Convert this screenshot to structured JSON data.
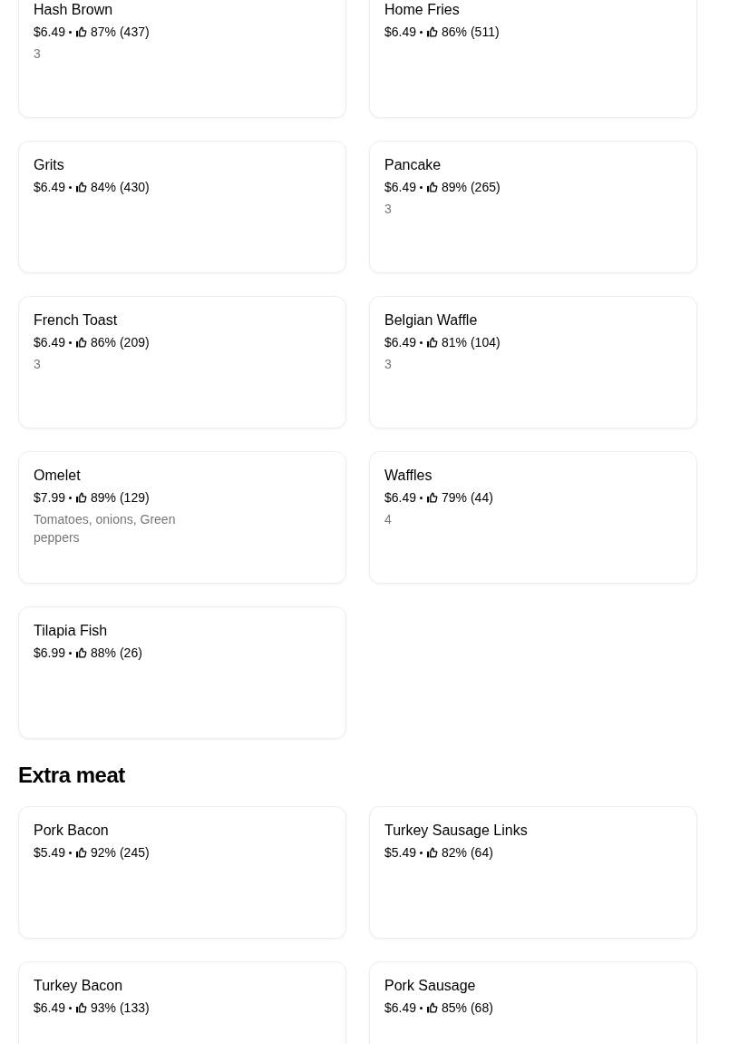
{
  "sections": [
    {
      "items": [
        {
          "name": "Hash Brown",
          "price": "$6.49",
          "rating": "87% (437)",
          "description": "3"
        },
        {
          "name": "Home Fries",
          "price": "$6.49",
          "rating": "86% (511)"
        },
        {
          "name": "Grits",
          "price": "$6.49",
          "rating": "84% (430)"
        },
        {
          "name": "Pancake",
          "price": "$6.49",
          "rating": "89% (265)",
          "description": "3"
        },
        {
          "name": "French Toast",
          "price": "$6.49",
          "rating": "86% (209)",
          "description": "3"
        },
        {
          "name": "Belgian Waffle",
          "price": "$6.49",
          "rating": "81% (104)",
          "description": "3"
        },
        {
          "name": "Omelet",
          "price": "$7.99",
          "rating": "89% (129)",
          "description": "Tomatoes, onions, Green peppers"
        },
        {
          "name": "Waffles",
          "price": "$6.49",
          "rating": "79% (44)",
          "description": "4"
        },
        {
          "name": "Tilapia Fish",
          "price": "$6.99",
          "rating": "88% (26)"
        }
      ]
    },
    {
      "title": "Extra meat",
      "items": [
        {
          "name": "Pork Bacon",
          "price": "$5.49",
          "rating": "92% (245)"
        },
        {
          "name": "Turkey Sausage Links",
          "price": "$5.49",
          "rating": "82% (64)"
        },
        {
          "name": "Turkey Bacon",
          "price": "$6.49",
          "rating": "93% (133)"
        },
        {
          "name": "Pork Sausage",
          "price": "$6.49",
          "rating": "85% (68)"
        }
      ]
    }
  ]
}
